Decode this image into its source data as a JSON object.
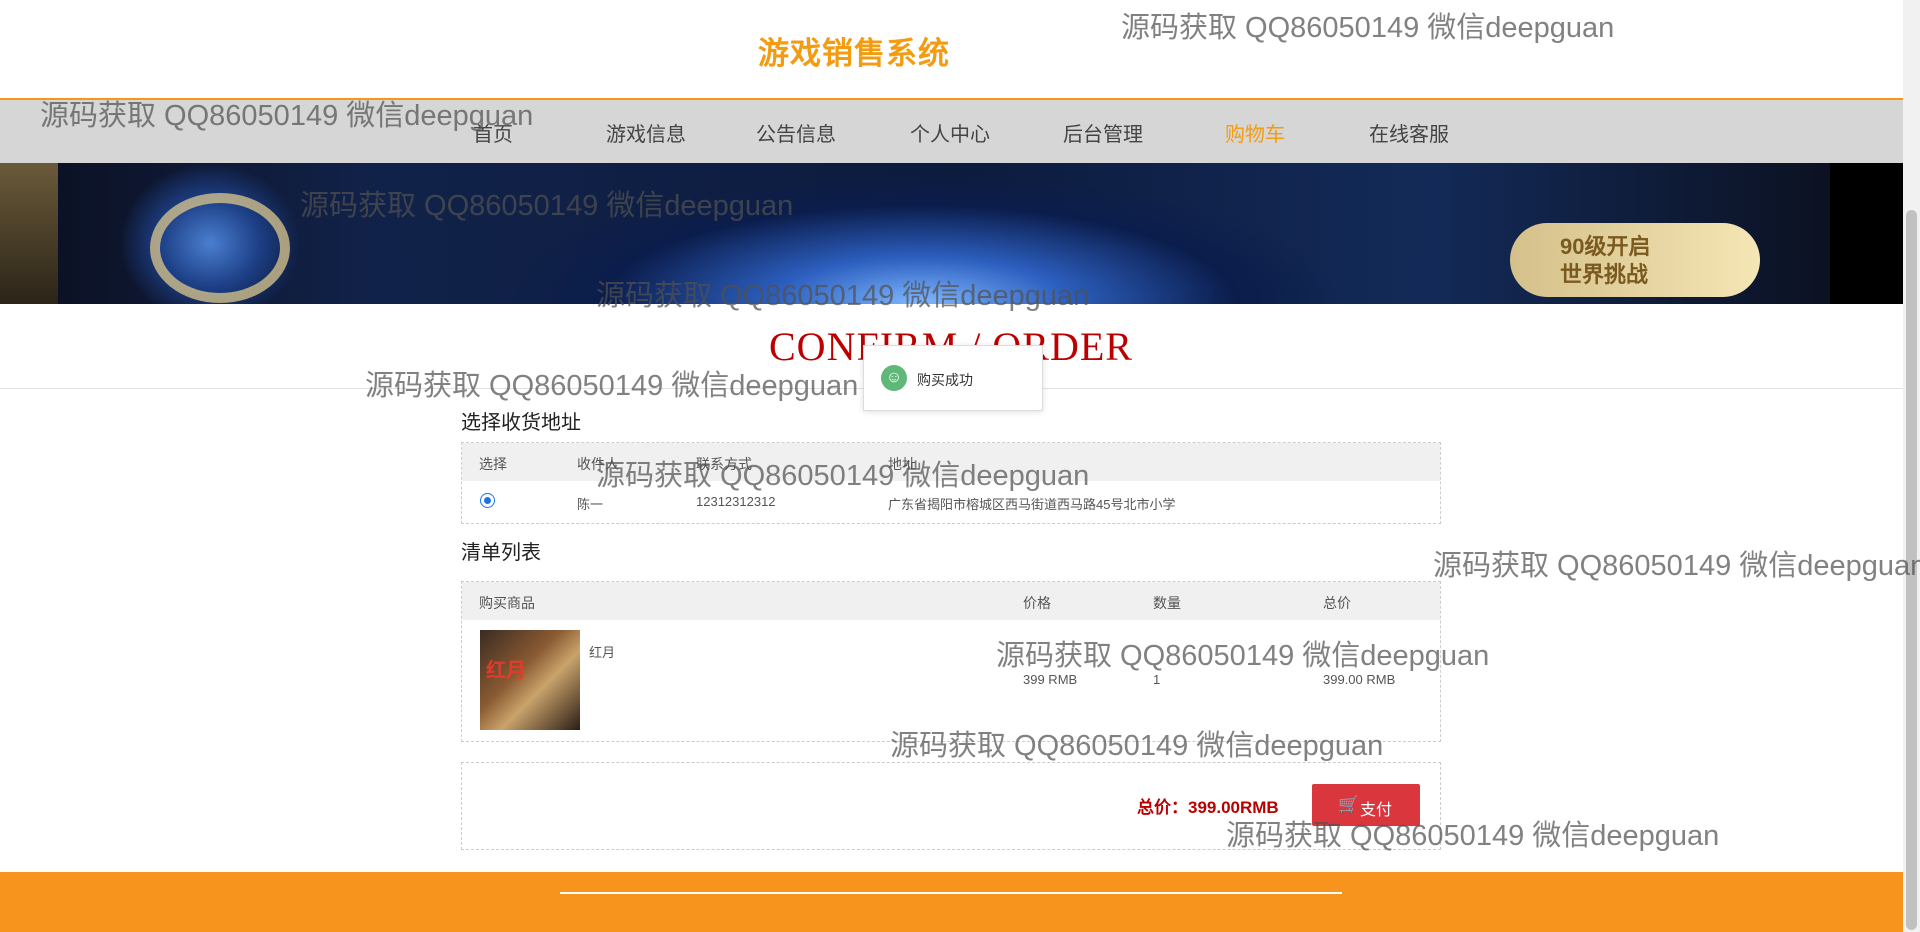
{
  "header": {
    "site_title": "游戏销售系统"
  },
  "nav": {
    "items": [
      {
        "label": "首页"
      },
      {
        "label": "游戏信息"
      },
      {
        "label": "公告信息"
      },
      {
        "label": "个人中心"
      },
      {
        "label": "后台管理"
      },
      {
        "label": "购物车"
      },
      {
        "label": "在线客服"
      }
    ],
    "active": "购物车"
  },
  "banner": {
    "badge_line1": "90级开启",
    "badge_line2": "世界挑战"
  },
  "page": {
    "confirm_title": "CONFIRM / ORDER"
  },
  "toast": {
    "message": "购买成功"
  },
  "address_section": {
    "title": "选择收货地址",
    "columns": [
      "选择",
      "收件人",
      "联系方式",
      "地址"
    ],
    "rows": [
      {
        "selected": true,
        "recipient": "陈一",
        "phone": "12312312312",
        "address": "广东省揭阳市榕城区西马街道西马路45号北市小学"
      }
    ]
  },
  "items_section": {
    "title": "清单列表",
    "columns": [
      "购买商品",
      "价格",
      "数量",
      "总价"
    ],
    "rows": [
      {
        "product_name": "红月",
        "price": "399 RMB",
        "quantity": "1",
        "total": "399.00 RMB"
      }
    ]
  },
  "checkout": {
    "total_label": "总价：399.00RMB",
    "pay_label": "支付"
  },
  "watermark": "源码获取 QQ86050149 微信deepguan",
  "colors": {
    "accent": "#f39c12",
    "title_red": "#b00000",
    "pay_button": "#d9363e",
    "footer": "#f7941d"
  }
}
